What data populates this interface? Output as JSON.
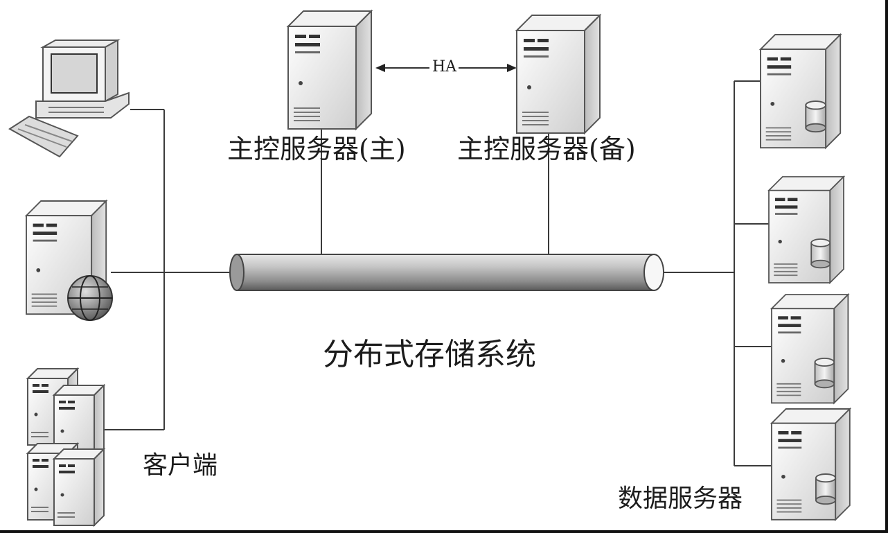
{
  "diagram": {
    "master_primary_label": "主控服务器(主)",
    "master_backup_label": "主控服务器(备)",
    "ha_label": "HA",
    "system_label": "分布式存储系统",
    "client_label": "客户端",
    "data_server_label": "数据服务器"
  }
}
